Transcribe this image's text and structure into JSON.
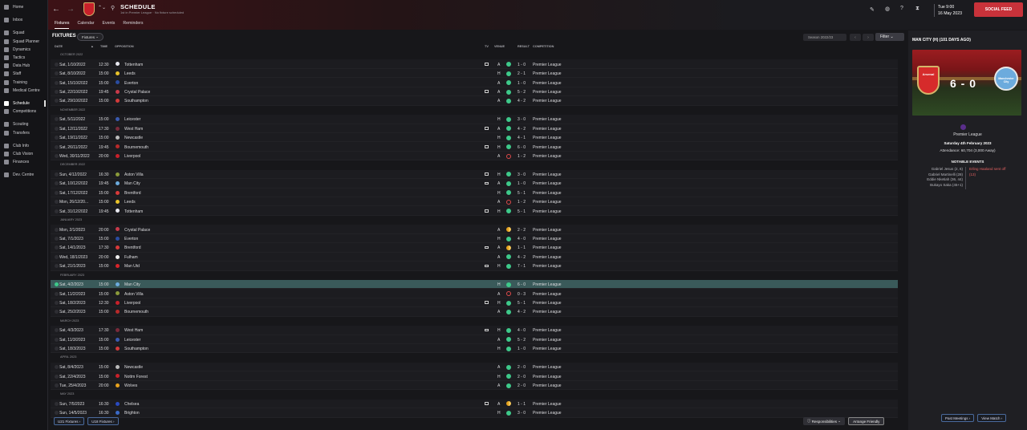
{
  "sidebar": {
    "items": [
      {
        "label": "Home",
        "icon": "home-icon"
      },
      {
        "label": "Inbox",
        "icon": "inbox-icon"
      },
      {
        "label": "Squad",
        "icon": "squad-icon"
      },
      {
        "label": "Squad Planner",
        "icon": "planner-icon"
      },
      {
        "label": "Dynamics",
        "icon": "dynamics-icon"
      },
      {
        "label": "Tactics",
        "icon": "tactics-icon"
      },
      {
        "label": "Data Hub",
        "icon": "data-hub-icon"
      },
      {
        "label": "Staff",
        "icon": "staff-icon"
      },
      {
        "label": "Training",
        "icon": "training-icon"
      },
      {
        "label": "Medical Centre",
        "icon": "medical-icon"
      },
      {
        "label": "Schedule",
        "icon": "calendar-icon"
      },
      {
        "label": "Competitions",
        "icon": "trophy-icon"
      },
      {
        "label": "Scouting",
        "icon": "scouting-icon"
      },
      {
        "label": "Transfers",
        "icon": "transfers-icon"
      },
      {
        "label": "Club Info",
        "icon": "club-info-icon"
      },
      {
        "label": "Club Vision",
        "icon": "vision-icon"
      },
      {
        "label": "Finances",
        "icon": "finances-icon"
      },
      {
        "label": "Dev. Centre",
        "icon": "dev-centre-icon"
      }
    ]
  },
  "header": {
    "title": "SCHEDULE",
    "subtitle": "1st in Premier League · No fixture scheduled",
    "time": "Tue 9:00",
    "date": "16 May 2023",
    "social_label": "SOCIAL FEED",
    "tabs": [
      "Fixtures",
      "Calendar",
      "Events",
      "Reminders"
    ]
  },
  "fixtures": {
    "heading": "FIXTURES",
    "dropdown": "Fixtures",
    "season": "Season 2022/23",
    "filter": "Filter",
    "columns": {
      "date": "DATE",
      "time": "TIME",
      "opposition": "OPPOSITION",
      "tv": "TV",
      "venue": "VENUE",
      "result": "RESULT",
      "competition": "COMPETITION"
    },
    "rows": [
      {
        "month": "OCTOBER 2022"
      },
      {
        "date": "Sat, 1/10/2022",
        "time": "12:30",
        "opp": "Tottenham",
        "tv": true,
        "venue": "A",
        "result": "1 - 0",
        "outcome": "W",
        "comp": "Premier League",
        "crest": "#e8e8f0"
      },
      {
        "date": "Sat, 8/10/2022",
        "time": "15:00",
        "opp": "Leeds",
        "tv": false,
        "venue": "H",
        "result": "2 - 1",
        "outcome": "W",
        "comp": "Premier League",
        "crest": "#e8c22a"
      },
      {
        "date": "Sat, 15/10/2022",
        "time": "15:00",
        "opp": "Everton",
        "tv": false,
        "venue": "A",
        "result": "1 - 0",
        "outcome": "W",
        "comp": "Premier League",
        "crest": "#2a4ca0"
      },
      {
        "date": "Sat, 22/10/2022",
        "time": "19:45",
        "opp": "Crystal Palace",
        "tv": true,
        "venue": "A",
        "result": "5 - 2",
        "outcome": "W",
        "comp": "Premier League",
        "crest": "#c83a4a"
      },
      {
        "date": "Sat, 29/10/2022",
        "time": "15:00",
        "opp": "Southampton",
        "tv": false,
        "venue": "A",
        "result": "4 - 2",
        "outcome": "W",
        "comp": "Premier League",
        "crest": "#d33a3a"
      },
      {
        "month": "NOVEMBER 2022"
      },
      {
        "date": "Sat, 5/11/2022",
        "time": "15:00",
        "opp": "Leicester",
        "tv": false,
        "venue": "H",
        "result": "3 - 0",
        "outcome": "W",
        "comp": "Premier League",
        "crest": "#3a5ab0"
      },
      {
        "date": "Sat, 12/11/2022",
        "time": "17:30",
        "opp": "West Ham",
        "tv": true,
        "venue": "A",
        "result": "4 - 2",
        "outcome": "W",
        "comp": "Premier League",
        "crest": "#7a2a3a"
      },
      {
        "date": "Sat, 19/11/2022",
        "time": "15:00",
        "opp": "Newcastle",
        "tv": false,
        "venue": "H",
        "result": "4 - 1",
        "outcome": "W",
        "comp": "Premier League",
        "crest": "#bbbbbb"
      },
      {
        "date": "Sat, 26/11/2022",
        "time": "19:45",
        "opp": "Bournemouth",
        "tv": true,
        "venue": "H",
        "result": "6 - 0",
        "outcome": "W",
        "comp": "Premier League",
        "crest": "#b82a2a"
      },
      {
        "date": "Wed, 30/11/2022",
        "time": "20:00",
        "opp": "Liverpool",
        "tv": false,
        "venue": "A",
        "result": "1 - 2",
        "outcome": "L",
        "comp": "Premier League",
        "crest": "#c8202a"
      },
      {
        "month": "DECEMBER 2022"
      },
      {
        "date": "Sun, 4/12/2022",
        "time": "16:30",
        "opp": "Aston Villa",
        "tv": true,
        "venue": "H",
        "result": "3 - 0",
        "outcome": "W",
        "comp": "Premier League",
        "crest": "#8a9a3a"
      },
      {
        "date": "Sat, 10/12/2022",
        "time": "19:45",
        "opp": "Man City",
        "tv": true,
        "venue": "A",
        "result": "1 - 0",
        "outcome": "W",
        "comp": "Premier League",
        "crest": "#6cabdd"
      },
      {
        "date": "Sat, 17/12/2022",
        "time": "15:00",
        "opp": "Brentford",
        "tv": false,
        "venue": "H",
        "result": "5 - 1",
        "outcome": "W",
        "comp": "Premier League",
        "crest": "#d83a3a"
      },
      {
        "date": "Mon, 26/12/20...",
        "time": "15:00",
        "opp": "Leeds",
        "tv": false,
        "venue": "A",
        "result": "1 - 2",
        "outcome": "L",
        "comp": "Premier League",
        "crest": "#e8c22a"
      },
      {
        "date": "Sat, 31/12/2022",
        "time": "19:45",
        "opp": "Tottenham",
        "tv": true,
        "venue": "H",
        "result": "5 - 1",
        "outcome": "W",
        "comp": "Premier League",
        "crest": "#e8e8f0"
      },
      {
        "month": "JANUARY 2023"
      },
      {
        "date": "Mon, 2/1/2023",
        "time": "20:00",
        "opp": "Crystal Palace",
        "tv": false,
        "venue": "A",
        "result": "2 - 2",
        "outcome": "D",
        "comp": "Premier League",
        "crest": "#c83a4a"
      },
      {
        "date": "Sat, 7/1/2023",
        "time": "15:00",
        "opp": "Everton",
        "tv": false,
        "venue": "H",
        "result": "4 - 0",
        "outcome": "W",
        "comp": "Premier League",
        "crest": "#2a4ca0"
      },
      {
        "date": "Sat, 14/1/2023",
        "time": "17:30",
        "opp": "Brentford",
        "tv": true,
        "venue": "A",
        "result": "1 - 1",
        "outcome": "D",
        "comp": "Premier League",
        "crest": "#d83a3a"
      },
      {
        "date": "Wed, 18/1/2023",
        "time": "20:00",
        "opp": "Fulham",
        "tv": false,
        "venue": "A",
        "result": "4 - 2",
        "outcome": "W",
        "comp": "Premier League",
        "crest": "#eeeeee"
      },
      {
        "date": "Sat, 21/1/2023",
        "time": "15:00",
        "opp": "Man Utd",
        "tv": true,
        "venue": "H",
        "result": "7 - 1",
        "outcome": "W",
        "comp": "Premier League",
        "crest": "#d8242a"
      },
      {
        "month": "FEBRUARY 2023"
      },
      {
        "date": "Sat, 4/2/2023",
        "time": "15:00",
        "opp": "Man City",
        "tv": false,
        "venue": "H",
        "result": "6 - 0",
        "outcome": "W",
        "comp": "Premier League",
        "crest": "#6cabdd",
        "selected": true
      },
      {
        "date": "Sat, 11/2/2023",
        "time": "15:00",
        "opp": "Aston Villa",
        "tv": false,
        "venue": "A",
        "result": "0 - 3",
        "outcome": "L",
        "comp": "Premier League",
        "crest": "#8a9a3a"
      },
      {
        "date": "Sat, 18/2/2023",
        "time": "12:30",
        "opp": "Liverpool",
        "tv": true,
        "venue": "H",
        "result": "5 - 1",
        "outcome": "W",
        "comp": "Premier League",
        "crest": "#c8202a"
      },
      {
        "date": "Sat, 25/2/2023",
        "time": "15:00",
        "opp": "Bournemouth",
        "tv": false,
        "venue": "A",
        "result": "4 - 2",
        "outcome": "W",
        "comp": "Premier League",
        "crest": "#b82a2a"
      },
      {
        "month": "MARCH 2023"
      },
      {
        "date": "Sat, 4/3/2023",
        "time": "17:30",
        "opp": "West Ham",
        "tv": true,
        "venue": "H",
        "result": "4 - 0",
        "outcome": "W",
        "comp": "Premier League",
        "crest": "#7a2a3a"
      },
      {
        "date": "Sat, 11/3/2023",
        "time": "15:00",
        "opp": "Leicester",
        "tv": false,
        "venue": "A",
        "result": "5 - 2",
        "outcome": "W",
        "comp": "Premier League",
        "crest": "#3a5ab0"
      },
      {
        "date": "Sat, 18/3/2023",
        "time": "15:00",
        "opp": "Southampton",
        "tv": false,
        "venue": "H",
        "result": "1 - 0",
        "outcome": "W",
        "comp": "Premier League",
        "crest": "#d33a3a"
      },
      {
        "month": "APRIL 2023"
      },
      {
        "date": "Sat, 8/4/2023",
        "time": "15:00",
        "opp": "Newcastle",
        "tv": false,
        "venue": "A",
        "result": "2 - 0",
        "outcome": "W",
        "comp": "Premier League",
        "crest": "#bbbbbb"
      },
      {
        "date": "Sat, 22/4/2023",
        "time": "15:00",
        "opp": "Nottm Forest",
        "tv": false,
        "venue": "H",
        "result": "2 - 0",
        "outcome": "W",
        "comp": "Premier League",
        "crest": "#c8202a"
      },
      {
        "date": "Tue, 25/4/2023",
        "time": "20:00",
        "opp": "Wolves",
        "tv": false,
        "venue": "A",
        "result": "2 - 0",
        "outcome": "W",
        "comp": "Premier League",
        "crest": "#e8a21d"
      },
      {
        "month": "MAY 2023"
      },
      {
        "date": "Sun, 7/5/2023",
        "time": "16:30",
        "opp": "Chelsea",
        "tv": true,
        "venue": "A",
        "result": "1 - 1",
        "outcome": "D",
        "comp": "Premier League",
        "crest": "#2a4ac0"
      },
      {
        "date": "Sun, 14/5/2023",
        "time": "16:30",
        "opp": "Brighton",
        "tv": false,
        "venue": "H",
        "result": "3 - 0",
        "outcome": "W",
        "comp": "Premier League",
        "crest": "#3a6ac8"
      }
    ],
    "footer": {
      "u21": "U21 Fixtures",
      "u18": "U18 Fixtures",
      "responsibilities": "Responsibilities",
      "arrange": "Arrange Friendly"
    }
  },
  "match": {
    "title": "MAN CITY (H) (101 DAYS AGO)",
    "score": "6 - 0",
    "home": "Arsenal",
    "away": "Manchester City",
    "competition": "Premier League",
    "date": "Saturday 4th February 2023",
    "attendance": "Attendance: 60,704 (3,000 Away)",
    "events_title": "NOTABLE EVENTS",
    "home_events": [
      "Gabriel Jesus (2, 6)",
      "Gabriel Martinelli (28)",
      "Eddie Nketiah (36, 44)",
      "Bukayo Saka (45+1)"
    ],
    "away_events": [
      "Erling Haaland sent off",
      "(13)"
    ],
    "past_meetings": "Past Meetings",
    "view_match": "View Match"
  },
  "colors": {
    "win": "#3ec98a",
    "draw": "#e6a21d",
    "loss": "#e04a4a",
    "accent": "#c8323a",
    "selected": "#3a5a5a"
  }
}
